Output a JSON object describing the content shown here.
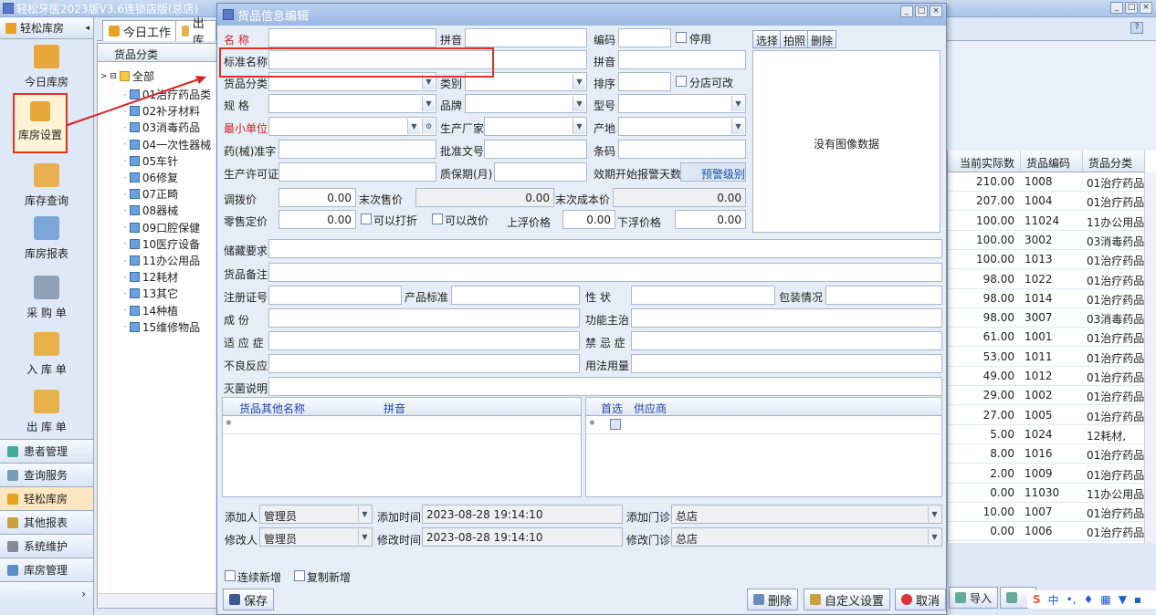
{
  "app": {
    "title": "轻松牙医2023版V3.6连锁店版(总店)"
  },
  "leftnav": {
    "header": "轻松库房",
    "items": [
      "今日库房",
      "库房设置",
      "库存查询",
      "库房报表",
      "采 购 单",
      "入 库 单",
      "出 库 单"
    ],
    "bottom": [
      "患者管理",
      "查询服务",
      "轻松库房",
      "其他报表",
      "系统维护",
      "库房管理"
    ]
  },
  "tabs": [
    "今日工作",
    "出 库"
  ],
  "tree": {
    "header": "货品分类",
    "root": "全部",
    "items": [
      "01治疗药品类",
      "02补牙材料",
      "03消毒药品",
      "04一次性器械",
      "05车针",
      "06修复",
      "07正畸",
      "08器械",
      "09口腔保健",
      "10医疗设备",
      "11办公用品",
      "12耗材",
      "13其它",
      "14种植",
      "15维修物品"
    ]
  },
  "grid": {
    "headers": [
      "当前实际数",
      "货品编码",
      "货品分类"
    ],
    "rows": [
      [
        "210.00",
        "1008",
        "01治疗药品类"
      ],
      [
        "207.00",
        "1004",
        "01治疗药品类"
      ],
      [
        "100.00",
        "11024",
        "11办公用品,"
      ],
      [
        "100.00",
        "3002",
        "03消毒药品,"
      ],
      [
        "100.00",
        "1013",
        "01治疗药品类"
      ],
      [
        "98.00",
        "1022",
        "01治疗药品类"
      ],
      [
        "98.00",
        "1014",
        "01治疗药品类"
      ],
      [
        "98.00",
        "3007",
        "03消毒药品,"
      ],
      [
        "61.00",
        "1001",
        "01治疗药品类"
      ],
      [
        "53.00",
        "1011",
        "01治疗药品类"
      ],
      [
        "49.00",
        "1012",
        "01治疗药品类"
      ],
      [
        "29.00",
        "1002",
        "01治疗药品类"
      ],
      [
        "27.00",
        "1005",
        "01治疗药品类"
      ],
      [
        "5.00",
        "1024",
        "12耗材,"
      ],
      [
        "8.00",
        "1016",
        "01治疗药品类"
      ],
      [
        "2.00",
        "1009",
        "01治疗药品类"
      ],
      [
        "0.00",
        "11030",
        "11办公用品,"
      ],
      [
        "10.00",
        "1007",
        "01治疗药品类"
      ],
      [
        "0.00",
        "1006",
        "01治疗药品类"
      ]
    ],
    "import_btn": "导入"
  },
  "dialog": {
    "title": "货品信息编辑",
    "labels": {
      "name": "名 称",
      "pinyin": "拼音",
      "code": "编码",
      "disabled": "停用",
      "std_name": "标准名称",
      "pinyin2": "拼音",
      "category": "货品分类",
      "type": "类别",
      "sort": "排序",
      "branch_edit": "分店可改",
      "spec": "规 格",
      "brand": "品牌",
      "model": "型号",
      "min_unit": "最小单位",
      "maker": "生产厂家",
      "origin": "产地",
      "reg": "药(械)准字",
      "approval": "批准文号",
      "barcode": "条码",
      "license": "生产许可证",
      "shelf": "质保期(月)",
      "expiry_days": "效期开始报警天数",
      "transfer_price": "调拨价",
      "last_sale": "末次售价",
      "last_cost": "末次成本价",
      "retail": "零售定价",
      "discount": "可以打折",
      "change_price": "可以改价",
      "float_up": "上浮价格",
      "float_down": "下浮价格",
      "storage": "储藏要求",
      "remark": "货品备注",
      "reg_no": "注册证号",
      "product_std": "产品标准",
      "property": "性 状",
      "package": "包装情况",
      "ingredient": "成 份",
      "function": "功能主治",
      "indication": "适 应 症",
      "contra": "禁 忌 症",
      "adverse": "不良反应",
      "usage": "用法用量",
      "sterile": "灭菌说明",
      "added_by": "添加人",
      "added_time": "添加时间",
      "added_clinic": "添加门诊",
      "mod_by": "修改人",
      "mod_time": "修改时间",
      "mod_clinic": "修改门诊",
      "continuous": "连续新增",
      "copy_new": "复制新增"
    },
    "values": {
      "transfer_price": "0.00",
      "last_sale": "0.00",
      "last_cost": "0.00",
      "retail": "0.00",
      "float_up": "0.00",
      "float_down": "0.00",
      "added_by": "管理员",
      "added_time": "2023-08-28 19:14:10",
      "added_clinic": "总店",
      "mod_by": "管理员",
      "mod_time": "2023-08-28 19:14:10",
      "mod_clinic": "总店"
    },
    "image_buttons": [
      "选择",
      "拍照",
      "删除"
    ],
    "no_image": "没有图像数据",
    "warn_btn": "预警级别",
    "alias_grid": [
      "货品其他名称",
      "拼音"
    ],
    "supplier_grid": [
      "首选",
      "供应商"
    ],
    "buttons": {
      "save": "保存",
      "delete": "删除",
      "custom": "自定义设置",
      "cancel": "取消"
    }
  }
}
